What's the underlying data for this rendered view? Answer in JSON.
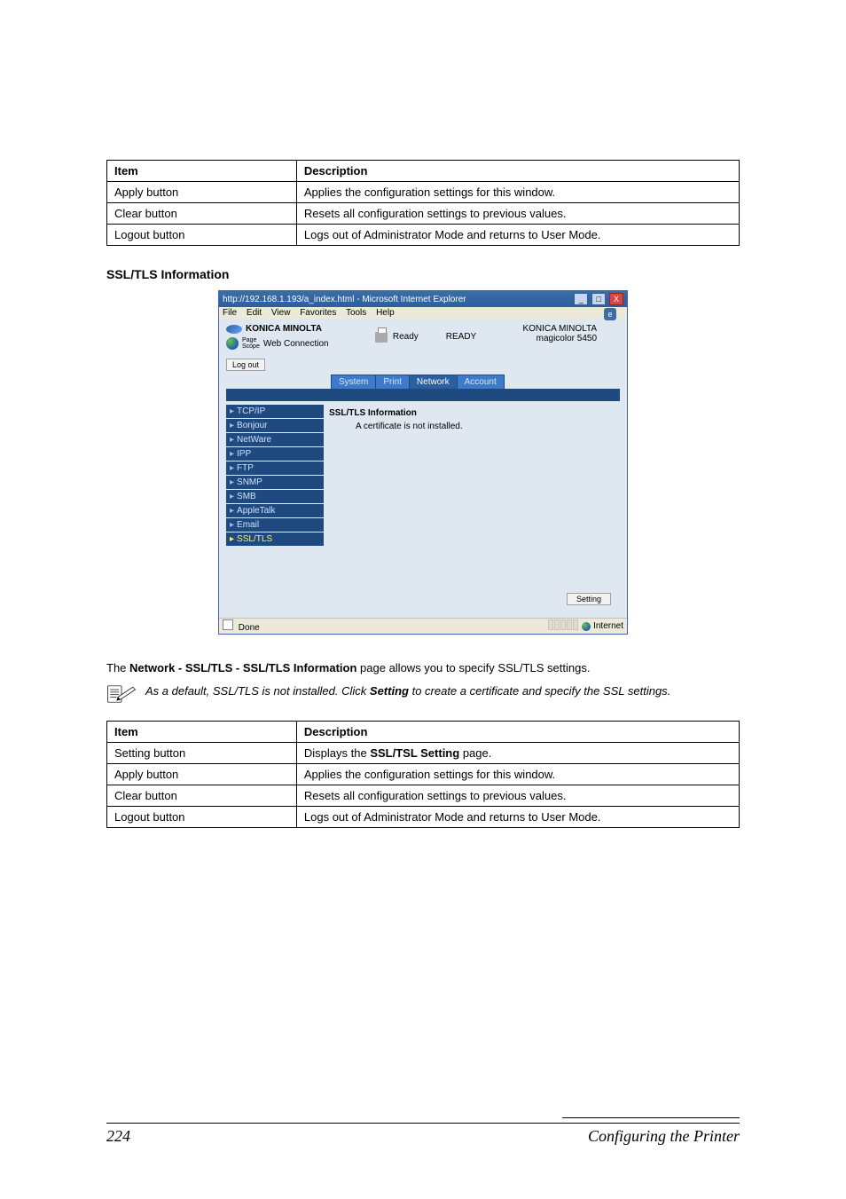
{
  "top_table": {
    "head": {
      "item": "Item",
      "desc": "Description"
    },
    "rows": [
      {
        "item": "Apply button",
        "desc": "Applies the configuration settings for this window."
      },
      {
        "item": "Clear button",
        "desc": "Resets all configuration settings to previous values."
      },
      {
        "item": "Logout button",
        "desc": "Logs out of Administrator Mode and returns to User Mode."
      }
    ]
  },
  "section_heading": "SSL/TLS Information",
  "ie": {
    "title": "http://192.168.1.193/a_index.html - Microsoft Internet Explorer",
    "menu": [
      "File",
      "Edit",
      "View",
      "Favorites",
      "Tools",
      "Help"
    ],
    "brand1": "KONICA MINOLTA",
    "brand2_prefix": "Page",
    "brand2_prefix2": "Scope",
    "brand2": "Web Connection",
    "status_label": "Ready",
    "status_big": "READY",
    "model_line1": "KONICA MINOLTA",
    "model_line2": "magicolor 5450",
    "logout": "Log out",
    "tabs": [
      "System",
      "Print",
      "Network",
      "Account"
    ],
    "sidenav": [
      "TCP/IP",
      "Bonjour",
      "NetWare",
      "IPP",
      "FTP",
      "SNMP",
      "SMB",
      "AppleTalk",
      "Email",
      "SSL/TLS"
    ],
    "content_title": "SSL/TLS Information",
    "content_msg": "A certificate is not installed.",
    "setting_btn": "Setting",
    "status_done": "Done",
    "status_zone": "Internet"
  },
  "para_intro_prefix": "The ",
  "para_intro_bold": "Network - SSL/TLS - SSL/TLS Information",
  "para_intro_suffix": " page allows you to specify SSL/TLS settings.",
  "note_text_prefix": "As a default, SSL/TLS is not installed. Click ",
  "note_text_bold": "Setting",
  "note_text_suffix": " to create a certificate and specify the SSL settings.",
  "bottom_table": {
    "head": {
      "item": "Item",
      "desc": "Description"
    },
    "rows": [
      {
        "item": "Setting button",
        "desc_prefix": "Displays the ",
        "desc_bold": "SSL/TSL Setting",
        "desc_suffix": " page."
      },
      {
        "item": "Apply button",
        "desc": "Applies the configuration settings for this window."
      },
      {
        "item": "Clear button",
        "desc": "Resets all configuration settings to previous values."
      },
      {
        "item": "Logout button",
        "desc": "Logs out of Administrator Mode and returns to User Mode."
      }
    ]
  },
  "footer": {
    "page_no": "224",
    "title": "Configuring the Printer"
  }
}
